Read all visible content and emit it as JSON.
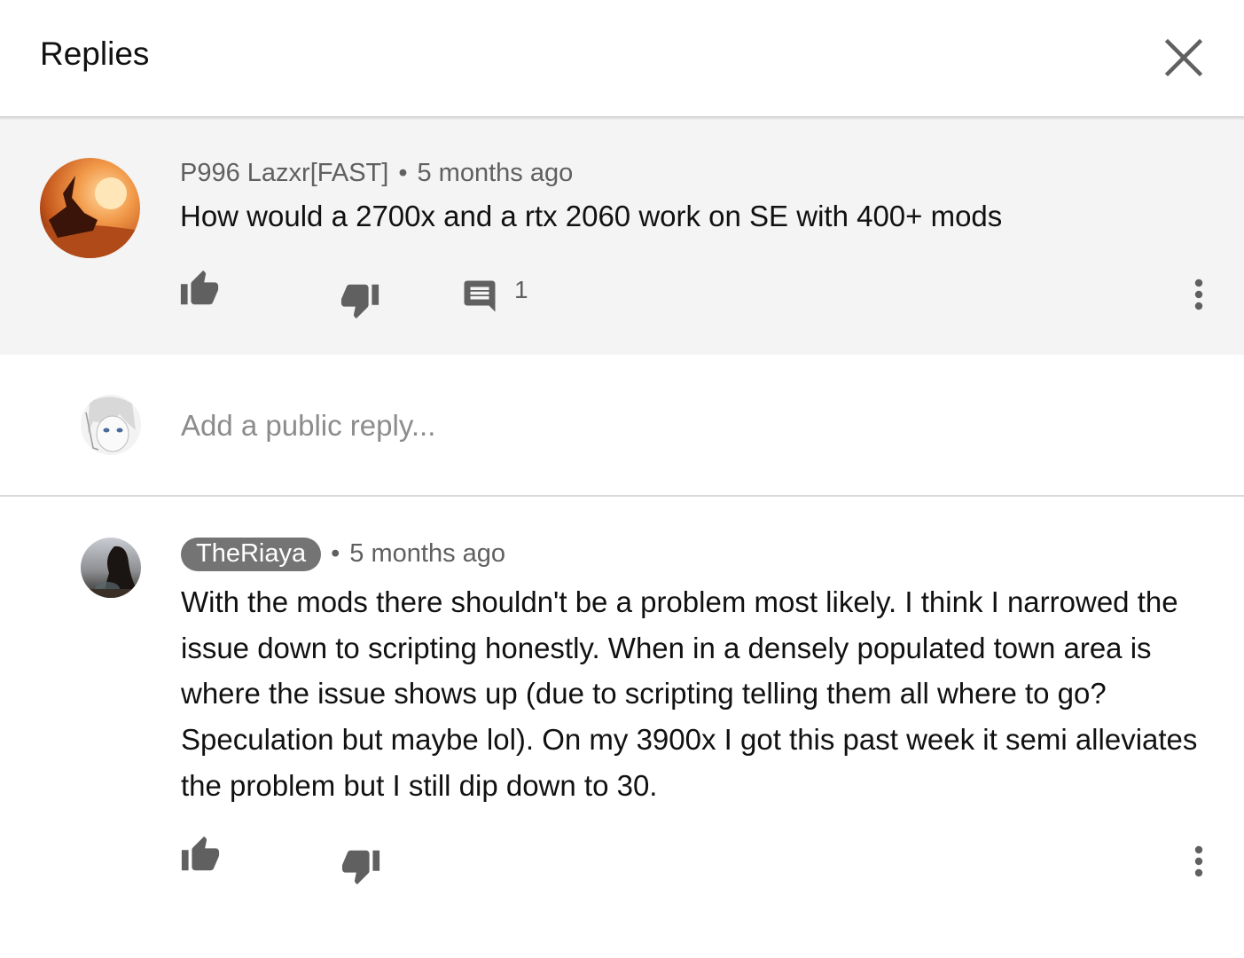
{
  "header": {
    "title": "Replies",
    "close_icon": "close-icon"
  },
  "parent_comment": {
    "author": "P996 Lazxr[FAST]",
    "separator": "•",
    "time": "5 months ago",
    "text": "How would a 2700x and a rtx 2060 work on SE with 400+ mods",
    "reply_count": "1",
    "icons": [
      "thumb-up-icon",
      "thumb-down-icon",
      "comment-icon",
      "more-vert-icon"
    ]
  },
  "reply_box": {
    "placeholder": "Add a public reply..."
  },
  "reply": {
    "author": "TheRiaya",
    "separator": "•",
    "time": "5 months ago",
    "text": "With the mods there shouldn't be a problem most likely. I think I narrowed the issue down to scripting honestly. When in a densely populated town area is where the issue shows up (due to scripting telling them all where to go? Speculation but maybe lol). On my 3900x I got this past week it semi alleviates the problem but I still dip down to 30.",
    "icons": [
      "thumb-up-icon",
      "thumb-down-icon",
      "more-vert-icon"
    ]
  },
  "colors": {
    "parent_background": "#f4f4f4",
    "chip_background": "#747474",
    "icon_gray": "#606060"
  }
}
